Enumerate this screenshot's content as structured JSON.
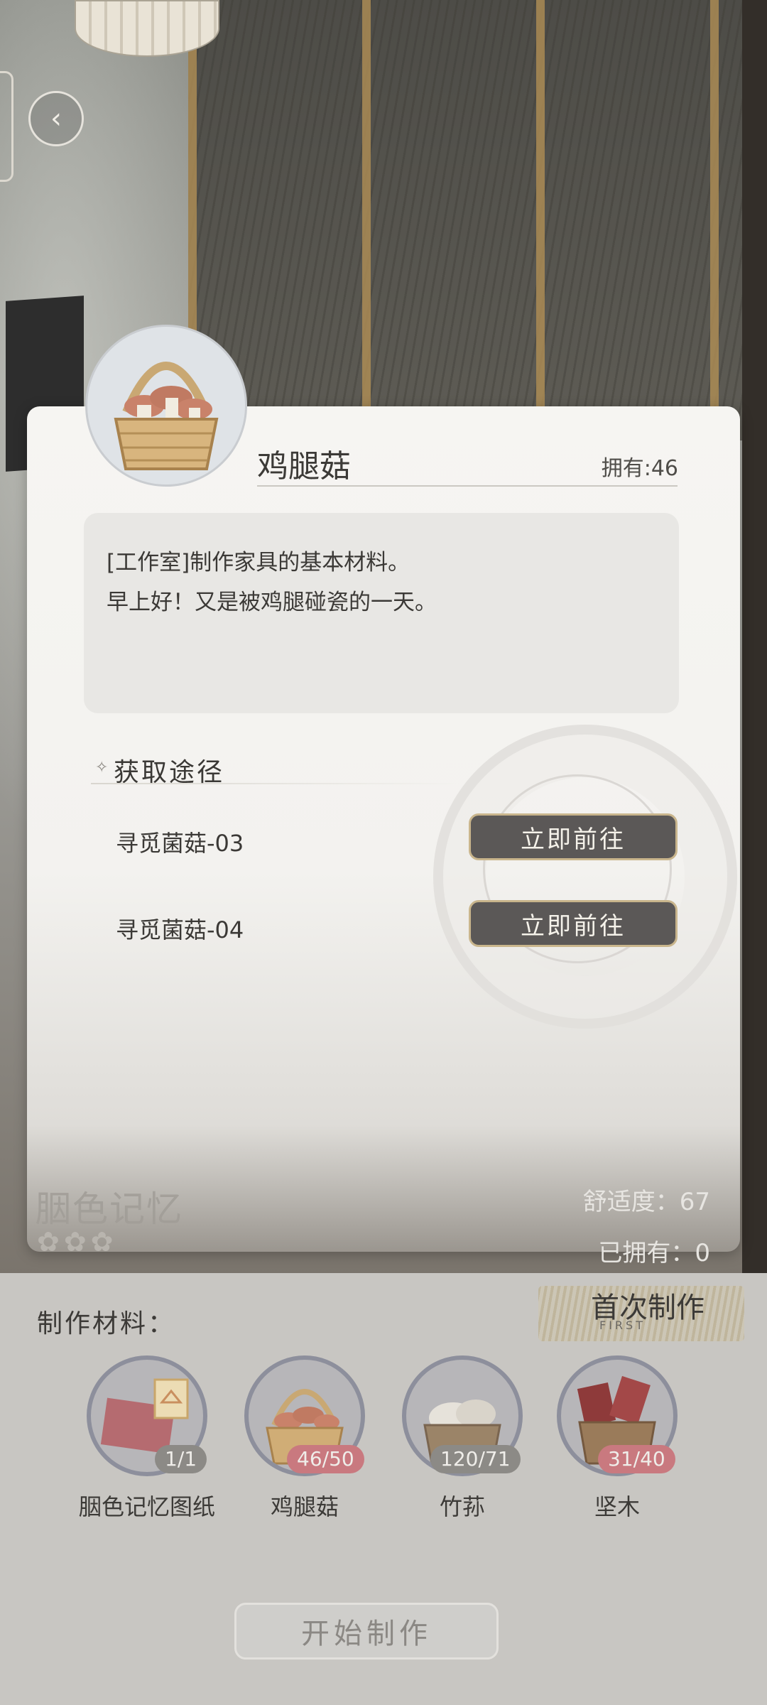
{
  "item": {
    "name": "鸡腿菇",
    "owned": "拥有:46",
    "description": [
      "[工作室]制作家具的基本材料。",
      "早上好！又是被鸡腿碰瓷的一天。"
    ]
  },
  "sources": {
    "title": "获取途径",
    "items": [
      {
        "name": "寻觅菌菇-03",
        "button": "立即前往"
      },
      {
        "name": "寻觅菌菇-04",
        "button": "立即前往"
      }
    ]
  },
  "furniture": {
    "name": "胭色记忆",
    "stars": "✿✿✿",
    "comfort": "舒适度：67",
    "owned": "已拥有：0"
  },
  "crafting": {
    "title": "制作材料：",
    "first_badge": "首次制作",
    "first_sub": "FIRST",
    "materials": [
      {
        "label": "胭色记忆图纸",
        "count": "1/1"
      },
      {
        "label": "鸡腿菇",
        "count": "46/50"
      },
      {
        "label": "竹荪",
        "count": "120/71"
      },
      {
        "label": "坚木",
        "count": "31/40"
      }
    ],
    "start_button": "开始制作"
  },
  "colors": {
    "button_bg": "#5b5857",
    "button_border": "#c9b58c",
    "insufficient_badge": "#c9797f",
    "sufficient_badge": "#8c8a86"
  },
  "icons": {
    "back": "back-arrow-icon",
    "source_bullet": "sparkle-icon"
  }
}
